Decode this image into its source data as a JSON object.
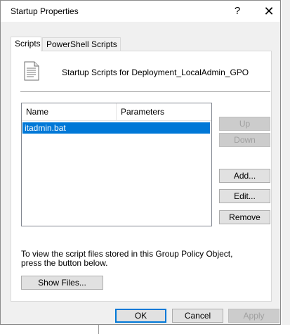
{
  "window": {
    "title": "Startup Properties",
    "help_glyph": "?",
    "close_glyph": "✕"
  },
  "tabs": [
    {
      "label": "Scripts",
      "active": true
    },
    {
      "label": "PowerShell Scripts",
      "active": false
    }
  ],
  "panel": {
    "header": "Startup Scripts for Deployment_LocalAdmin_GPO",
    "icon": "script-file-icon"
  },
  "list": {
    "columns": [
      "Name",
      "Parameters"
    ],
    "rows": [
      {
        "name": "itadmin.bat",
        "parameters": "",
        "selected": true
      }
    ]
  },
  "side_buttons": {
    "up": "Up",
    "down": "Down",
    "add": "Add...",
    "edit": "Edit...",
    "remove": "Remove"
  },
  "info_text": "To view the script files stored in this Group Policy Object, press the button below.",
  "show_files_label": "Show Files...",
  "footer": {
    "ok": "OK",
    "cancel": "Cancel",
    "apply": "Apply"
  },
  "colors": {
    "selection": "#0078d7",
    "dialog_bg": "#f0f0f0"
  }
}
